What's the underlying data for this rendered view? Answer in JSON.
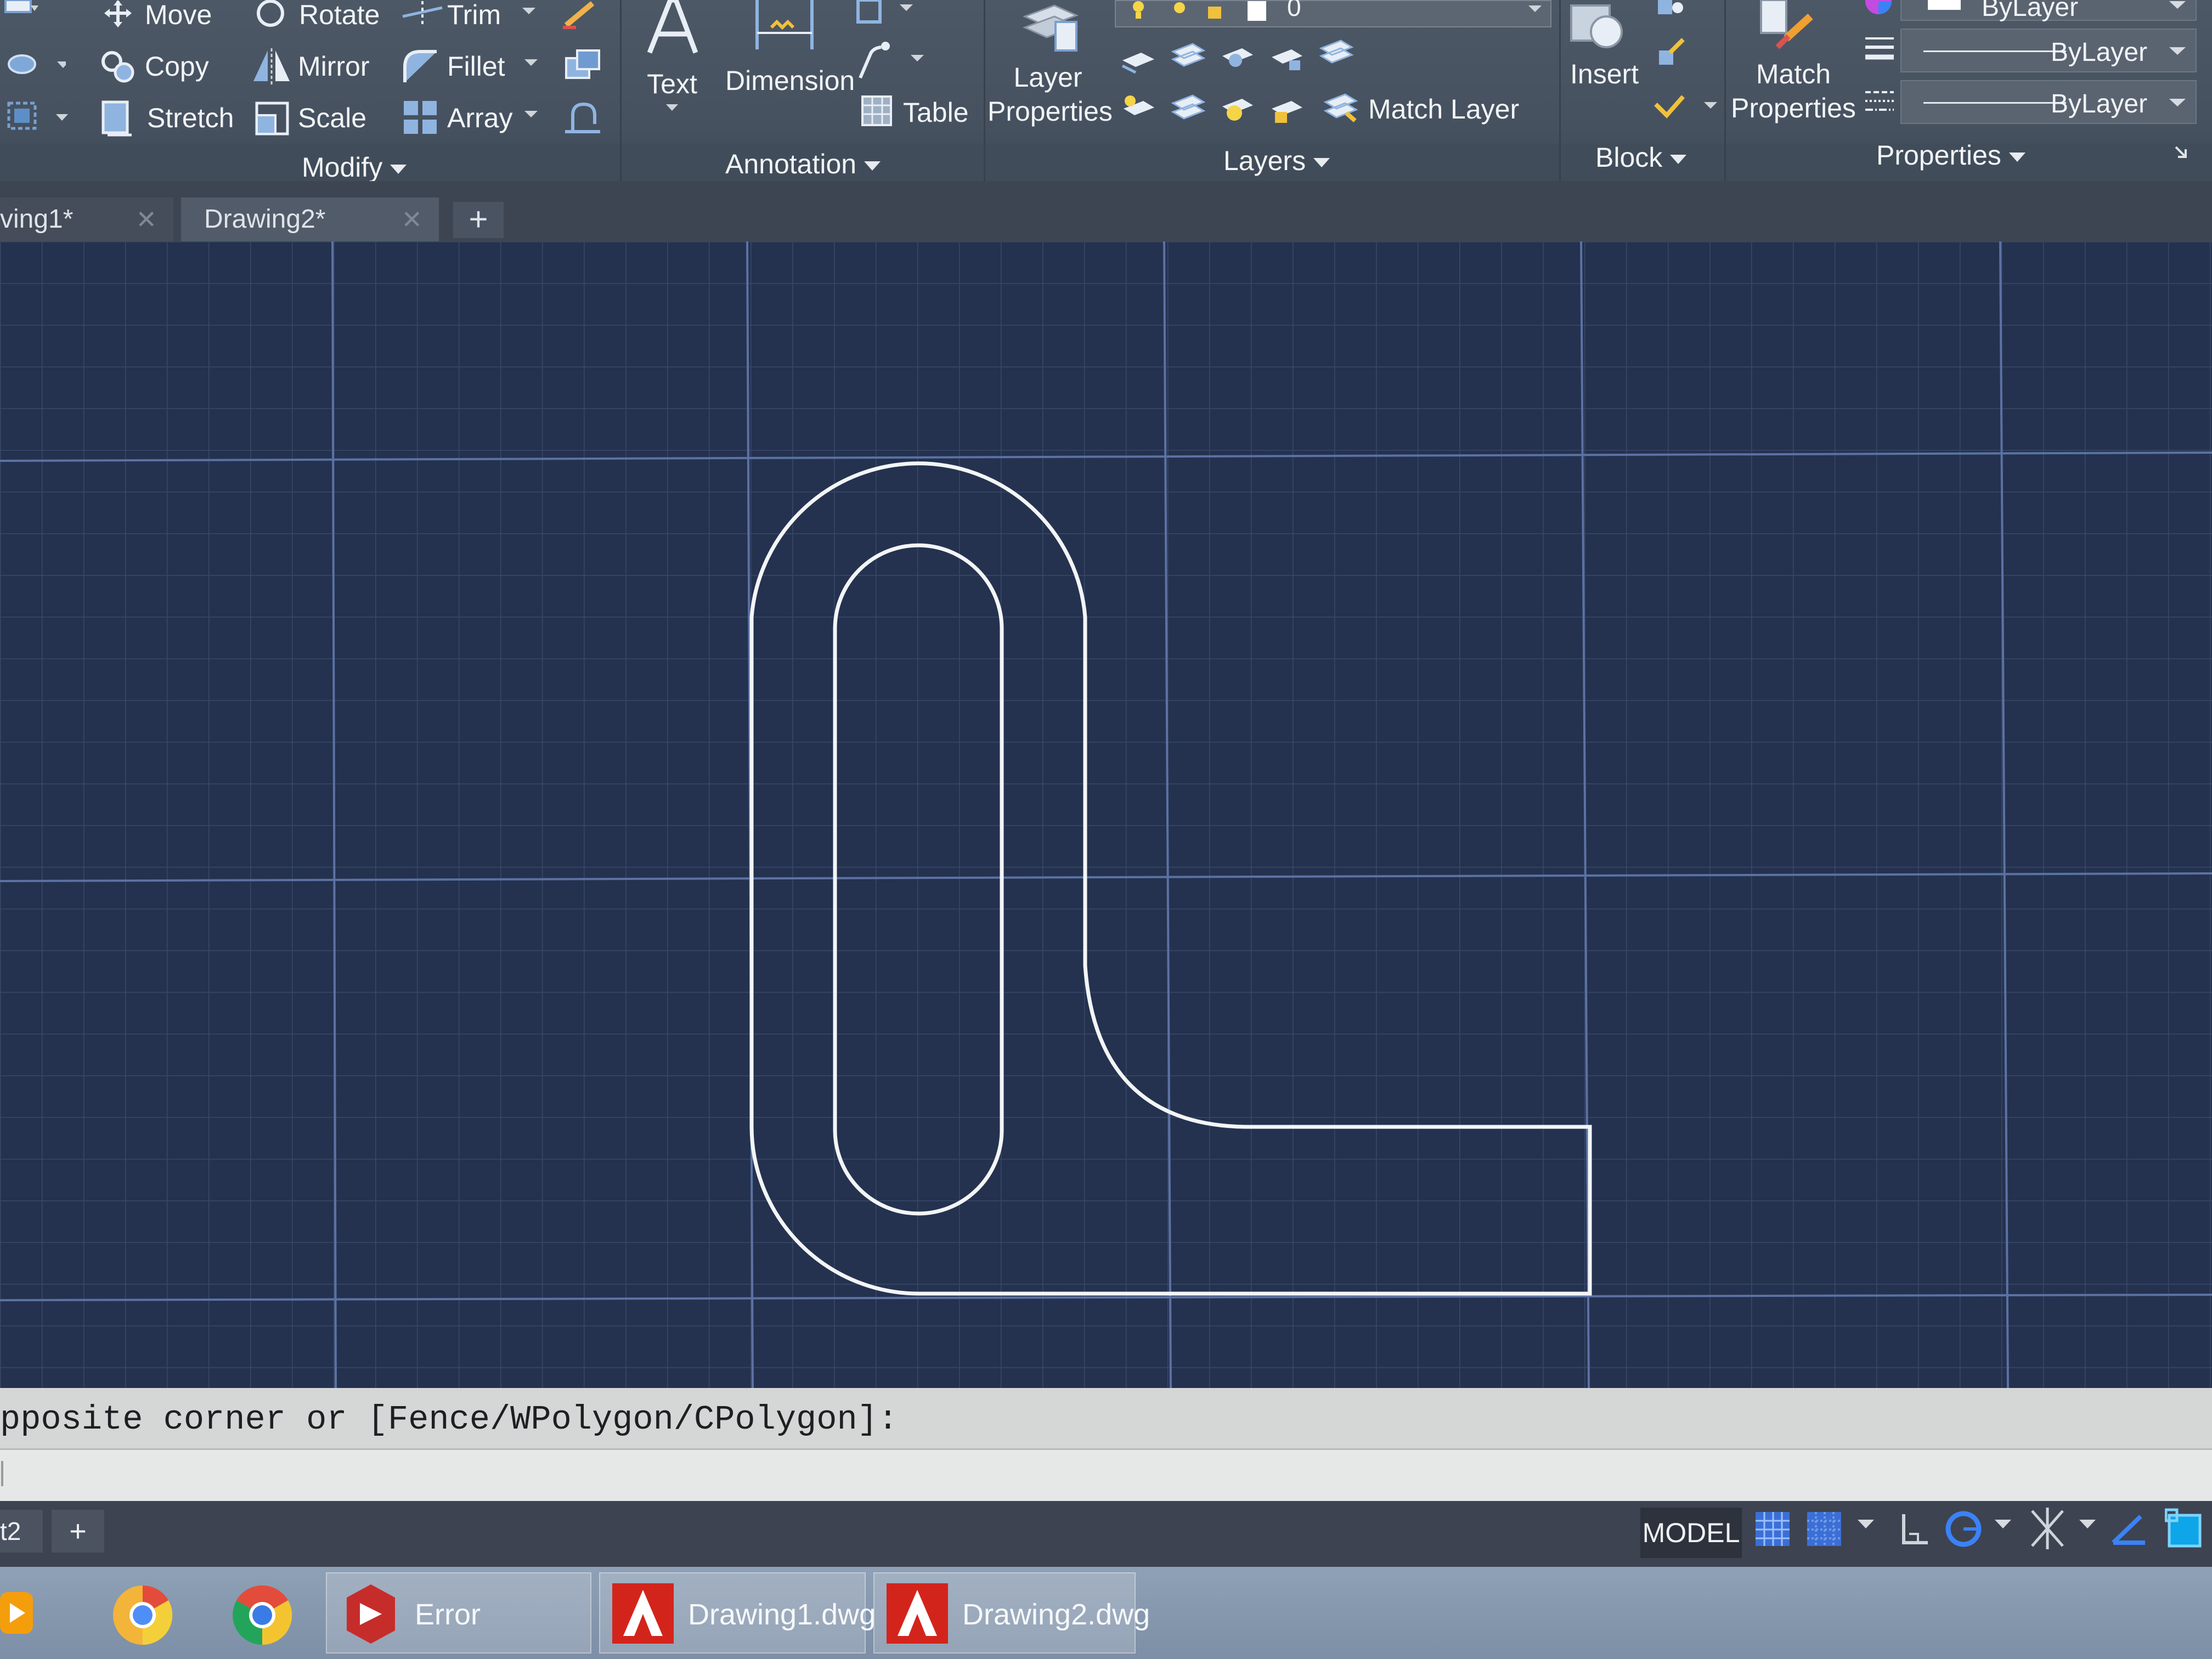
{
  "ribbon": {
    "modify": {
      "move": "Move",
      "rotate": "Rotate",
      "trim": "Trim",
      "copy": "Copy",
      "mirror": "Mirror",
      "fillet": "Fillet",
      "stretch": "Stretch",
      "scale": "Scale",
      "array": "Array",
      "panel_label": "Modify"
    },
    "annotation": {
      "text": "Text",
      "dimension": "Dimension",
      "table": "Table",
      "panel_label": "Annotation"
    },
    "layers": {
      "layer_properties_line1": "Layer",
      "layer_properties_line2": "Properties",
      "current_layer": "0",
      "match_layer": "Match Layer",
      "panel_label": "Layers"
    },
    "block": {
      "insert": "Insert",
      "panel_label": "Block"
    },
    "properties": {
      "match_line1": "Match",
      "match_line2": "Properties",
      "color": "ByLayer",
      "linetype": "ByLayer",
      "lineweight": "ByLayer",
      "panel_label": "Properties"
    }
  },
  "tabs": [
    {
      "label": "ving1*"
    },
    {
      "label": "Drawing2*"
    }
  ],
  "command_line": {
    "prompt": "pposite corner or [Fence/WPolygon/CPolygon]:",
    "input": ""
  },
  "status_bar": {
    "layout_tab": "t2",
    "model": "MODEL"
  },
  "taskbar": {
    "error": "Error",
    "drawing1": "Drawing1.dwg",
    "drawing2": "Drawing2.dwg"
  },
  "colors": {
    "canvas": "#24324f",
    "ribbon": "#4d5866",
    "autocad_red": "#d3241c"
  }
}
